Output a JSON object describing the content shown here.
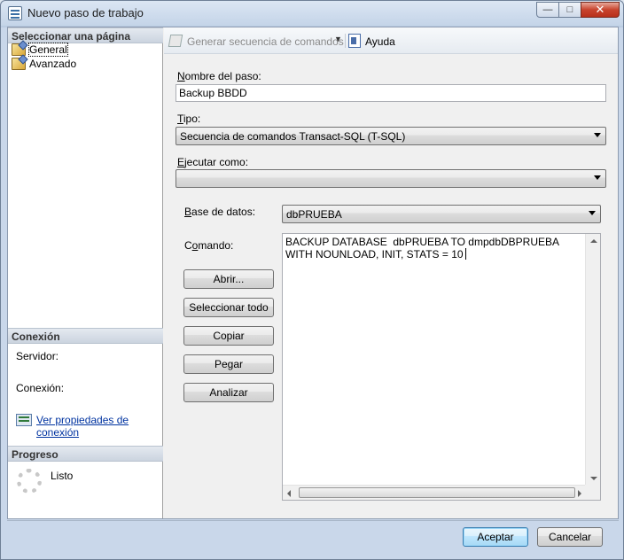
{
  "window": {
    "title": "Nuevo paso de trabajo"
  },
  "left_pane": {
    "select_page_header": "Seleccionar una página",
    "pages": [
      {
        "label": "General",
        "selected": true
      },
      {
        "label": "Avanzado",
        "selected": false
      }
    ],
    "connection_header": "Conexión",
    "server_label": "Servidor:",
    "connection_label": "Conexión:",
    "view_properties_link_line1": "Ver propiedades de",
    "view_properties_link_line2": "conexión",
    "progress_header": "Progreso",
    "progress_status": "Listo"
  },
  "toolbar": {
    "script_label": "Generar secuencia de comandos",
    "help_label": "Ayuda"
  },
  "form": {
    "step_name_label": "Nombre del paso:",
    "step_name_value": "Backup BBDD",
    "type_label": "Tipo:",
    "type_value": "Secuencia de comandos Transact-SQL (T-SQL)",
    "run_as_label": "Ejecutar como:",
    "run_as_value": "",
    "database_label": "Base de datos:",
    "database_value": "dbPRUEBA",
    "command_label": "Comando:",
    "command_text": "BACKUP DATABASE  dbPRUEBA TO dmpdbDBPRUEBA\nWITH NOUNLOAD, INIT, STATS = 10"
  },
  "command_buttons": {
    "open": "Abrir...",
    "select_all": "Seleccionar todo",
    "copy": "Copiar",
    "paste": "Pegar",
    "parse": "Analizar"
  },
  "dialog_buttons": {
    "ok": "Aceptar",
    "cancel": "Cancelar"
  }
}
